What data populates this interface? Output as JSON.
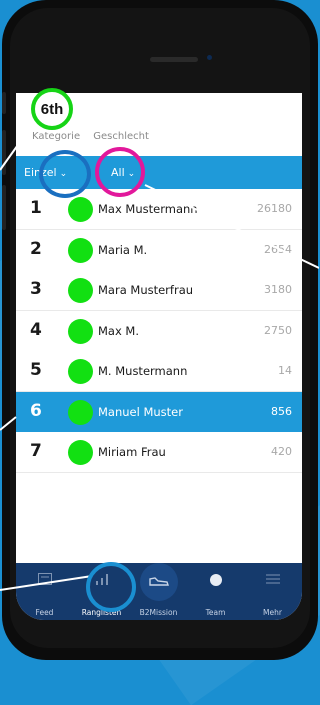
{
  "badge": {
    "text": "6th"
  },
  "filters": {
    "kategorie_label": "Kategorie",
    "geschlecht_label": "Geschlecht"
  },
  "dropdowns": {
    "kategorie_value": "Einzel",
    "geschlecht_value": "All"
  },
  "rows": [
    {
      "rank": "1",
      "name": "Max Mustermann",
      "points": "26180",
      "selected": false
    },
    {
      "rank": "2",
      "name": "Maria M.",
      "points": "2654",
      "selected": false
    },
    {
      "rank": "3",
      "name": "Mara Musterfrau",
      "points": "3180",
      "selected": false
    },
    {
      "rank": "4",
      "name": "Max M.",
      "points": "2750",
      "selected": false
    },
    {
      "rank": "5",
      "name": "M. Mustermann",
      "points": "14",
      "selected": false
    },
    {
      "rank": "6",
      "name": "Manuel Muster",
      "points": "856",
      "selected": true
    },
    {
      "rank": "7",
      "name": "Miriam Frau",
      "points": "420",
      "selected": false
    }
  ],
  "tabs": [
    {
      "label": "Feed",
      "icon": "feed-icon"
    },
    {
      "label": "Ranglisten",
      "icon": "bar-chart-icon",
      "active": true
    },
    {
      "label": "B2Mission",
      "icon": "shoe-icon"
    },
    {
      "label": "Team",
      "icon": "team-icon"
    },
    {
      "label": "Mehr",
      "icon": "menu-icon"
    }
  ],
  "colors": {
    "background": "#1a8fd1",
    "accent": "#1f9ad9",
    "tabbar": "#153a6c",
    "avatar_dot": "#12e012",
    "highlight_green": "#16d416",
    "highlight_magenta": "#e2189b",
    "highlight_blue": "#1a6fc0"
  }
}
